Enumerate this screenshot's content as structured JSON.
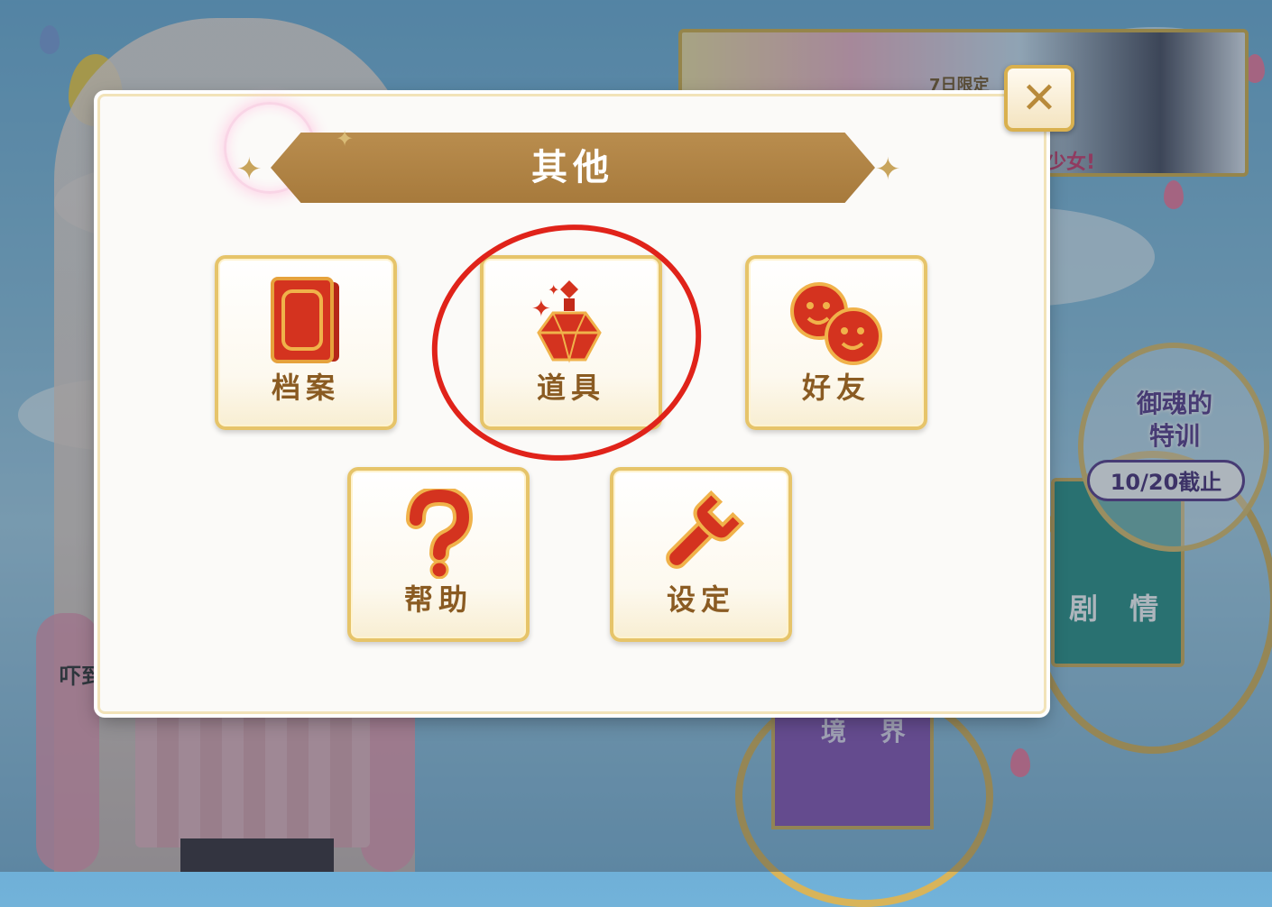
{
  "background": {
    "side_text": "吓到",
    "banner_top_text": "7日限定",
    "banner_bottom_text": "少女!",
    "event": {
      "title_line1": "御魂的",
      "title_line2": "特训",
      "deadline": "10/20截止"
    },
    "story_label": "剧 情",
    "boundary_label": "境 界"
  },
  "modal": {
    "title": "其他",
    "close_label": "✕",
    "tiles": [
      {
        "label": "档案",
        "icon": "card-icon"
      },
      {
        "label": "道具",
        "icon": "potion-icon"
      },
      {
        "label": "好友",
        "icon": "friends-icon"
      },
      {
        "label": "帮助",
        "icon": "help-icon"
      },
      {
        "label": "设定",
        "icon": "wrench-icon"
      }
    ]
  },
  "colors": {
    "accent_gold": "#e6c46a",
    "ribbon": "#a77a3c",
    "icon_red": "#d4331f",
    "label_brown": "#8a5b22",
    "annotation_red": "#e0231a"
  }
}
